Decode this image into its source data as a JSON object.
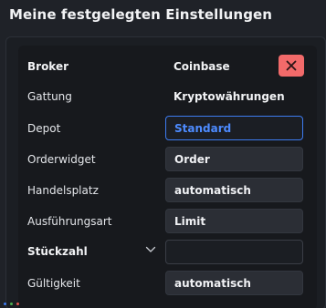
{
  "page": {
    "title": "Meine festgelegten Einstellungen"
  },
  "settings": {
    "broker": {
      "label": "Broker",
      "value": "Coinbase"
    },
    "gattung": {
      "label": "Gattung",
      "value": "Kryptowährungen"
    },
    "depot": {
      "label": "Depot",
      "value": "Standard"
    },
    "orderwidget": {
      "label": "Orderwidget",
      "value": "Order"
    },
    "handelsplatz": {
      "label": "Handelsplatz",
      "value": "automatisch"
    },
    "ausfuehrungsart": {
      "label": "Ausführungsart",
      "value": "Limit"
    },
    "stueckzahl": {
      "label": "Stückzahl",
      "value": ""
    },
    "gueltigkeit": {
      "label": "Gültigkeit",
      "value": "automatisch"
    }
  },
  "icons": {
    "close": "close-icon",
    "chevron": "chevron-down-icon"
  },
  "colors": {
    "background": "#1f2228",
    "card": "#17191d",
    "field": "#2b2e35",
    "accent_blue": "#3d7bf0",
    "close_red": "#f26a6a"
  }
}
